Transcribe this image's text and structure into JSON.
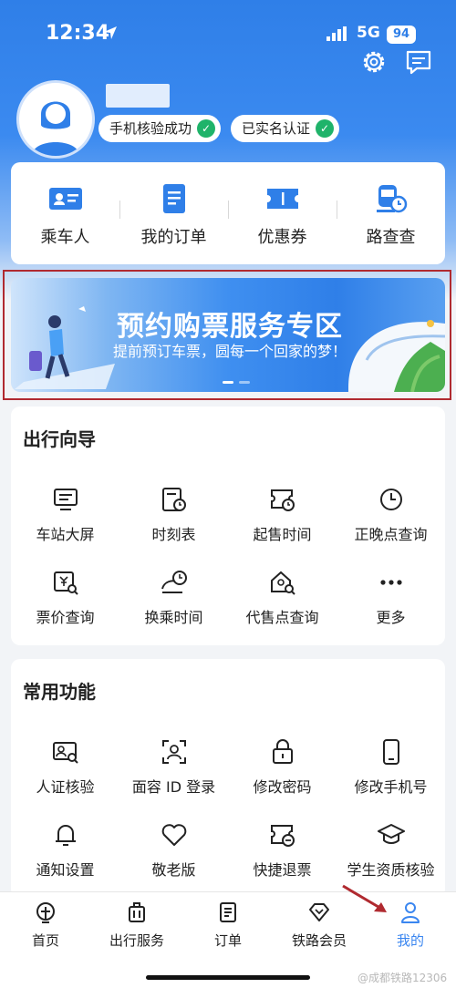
{
  "status_bar": {
    "time": "12:34",
    "network": "5G",
    "battery": "94"
  },
  "profile": {
    "badges": [
      "手机核验成功",
      "已实名认证"
    ],
    "check_glyph": "✓"
  },
  "quick_actions": [
    {
      "label": "乘车人",
      "icon": "passenger-card-icon"
    },
    {
      "label": "我的订单",
      "icon": "order-list-icon"
    },
    {
      "label": "优惠券",
      "icon": "coupon-icon"
    },
    {
      "label": "路查查",
      "icon": "route-query-icon"
    }
  ],
  "banner": {
    "title": "预约购票服务专区",
    "subtitle": "提前预订车票，圆每一个回家的梦！"
  },
  "travel_guide": {
    "title": "出行向导",
    "items": [
      {
        "label": "车站大屏",
        "icon": "station-screen-icon"
      },
      {
        "label": "时刻表",
        "icon": "timetable-icon"
      },
      {
        "label": "起售时间",
        "icon": "sale-time-icon"
      },
      {
        "label": "正晚点查询",
        "icon": "clock-icon"
      },
      {
        "label": "票价查询",
        "icon": "fare-query-icon"
      },
      {
        "label": "换乘时间",
        "icon": "transfer-time-icon"
      },
      {
        "label": "代售点查询",
        "icon": "agency-query-icon"
      },
      {
        "label": "更多",
        "icon": "more-dots-icon"
      }
    ]
  },
  "common_functions": {
    "title": "常用功能",
    "items": [
      {
        "label": "人证核验",
        "icon": "id-verify-icon"
      },
      {
        "label": "面容 ID 登录",
        "icon": "face-id-icon"
      },
      {
        "label": "修改密码",
        "icon": "lock-icon"
      },
      {
        "label": "修改手机号",
        "icon": "phone-icon"
      },
      {
        "label": "通知设置",
        "icon": "bell-icon"
      },
      {
        "label": "敬老版",
        "icon": "heart-icon"
      },
      {
        "label": "快捷退票",
        "icon": "quick-refund-icon"
      },
      {
        "label": "学生资质核验",
        "icon": "graduation-cap-icon"
      }
    ]
  },
  "tabbar": {
    "tabs": [
      {
        "label": "首页",
        "icon": "home-rail-icon"
      },
      {
        "label": "出行服务",
        "icon": "luggage-icon"
      },
      {
        "label": "订单",
        "icon": "order-icon"
      },
      {
        "label": "铁路会员",
        "icon": "diamond-icon"
      },
      {
        "label": "我的",
        "icon": "user-icon"
      }
    ],
    "active_tab": "我的",
    "active_color": "#3a86f0"
  },
  "watermark": "@成都铁路12306",
  "colors": {
    "primary": "#2f7fe8",
    "success": "#1fb36a",
    "annotation": "#b02a30"
  }
}
